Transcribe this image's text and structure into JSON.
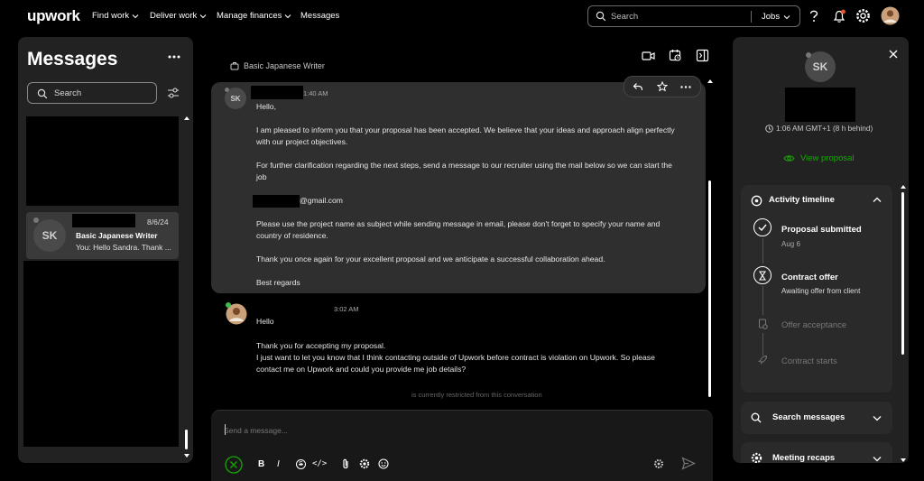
{
  "nav": {
    "logo": "upwork",
    "items": [
      {
        "label": "Find work",
        "dropdown": true
      },
      {
        "label": "Deliver work",
        "dropdown": true
      },
      {
        "label": "Manage finances",
        "dropdown": true
      },
      {
        "label": "Messages",
        "dropdown": false
      }
    ],
    "search_placeholder": "Search",
    "search_scope": "Jobs"
  },
  "left": {
    "title": "Messages",
    "search_label": "Search",
    "conversation": {
      "initials": "SK",
      "date": "8/6/24",
      "project": "Basic Japanese Writer",
      "preview": "You: Hello Sandra. Thank ..."
    }
  },
  "chat": {
    "project": "Basic Japanese Writer",
    "message1": {
      "initials": "SK",
      "time": "1:40 AM",
      "lines": [
        "Hello,",
        "I am pleased to inform you that your proposal has been accepted. We believe that your ideas and approach align perfectly",
        "with our project objectives.",
        "For further clarification regarding the next steps, send a message to our recruiter using the mail below so we can start the",
        "job",
        "@gmail.com",
        "Please use the project name as subject while sending message in email, please don't forget to specify your name and",
        "country of residence.",
        "Thank you once again for your excellent proposal and we anticipate a successful collaboration ahead.",
        "Best regards"
      ]
    },
    "message2": {
      "time": "3:02 AM",
      "lines": [
        "Hello",
        "Thank you for accepting my proposal.",
        "I just want to let you know that I think contacting outside of Upwork before contract is violation on Upwork. So please",
        "contact me on Upwork and could you provide me job details?"
      ]
    },
    "restricted_notice": "is currently restricted from this conversation",
    "composer_placeholder": "Send a message...",
    "toolbar": {
      "bold": "B",
      "italic": "I",
      "strike": "S",
      "code": "</>"
    }
  },
  "right": {
    "initials": "SK",
    "local_time": "1:06 AM GMT+1 (8 h behind)",
    "view_proposal": "View proposal",
    "timeline_title": "Activity timeline",
    "timeline": [
      {
        "label": "Proposal submitted",
        "sub": "Aug 6",
        "state": "done"
      },
      {
        "label": "Contract offer",
        "sub": "Awaiting offer from client",
        "state": "current"
      },
      {
        "label": "Offer acceptance",
        "sub": "",
        "state": "pending"
      },
      {
        "label": "Contract starts",
        "sub": "",
        "state": "pending"
      }
    ],
    "search_messages": "Search messages",
    "meeting_recaps": "Meeting recaps"
  },
  "colors": {
    "accent_green": "#14a800",
    "notification_red": "#e4572e",
    "online_green": "#3fb950"
  }
}
